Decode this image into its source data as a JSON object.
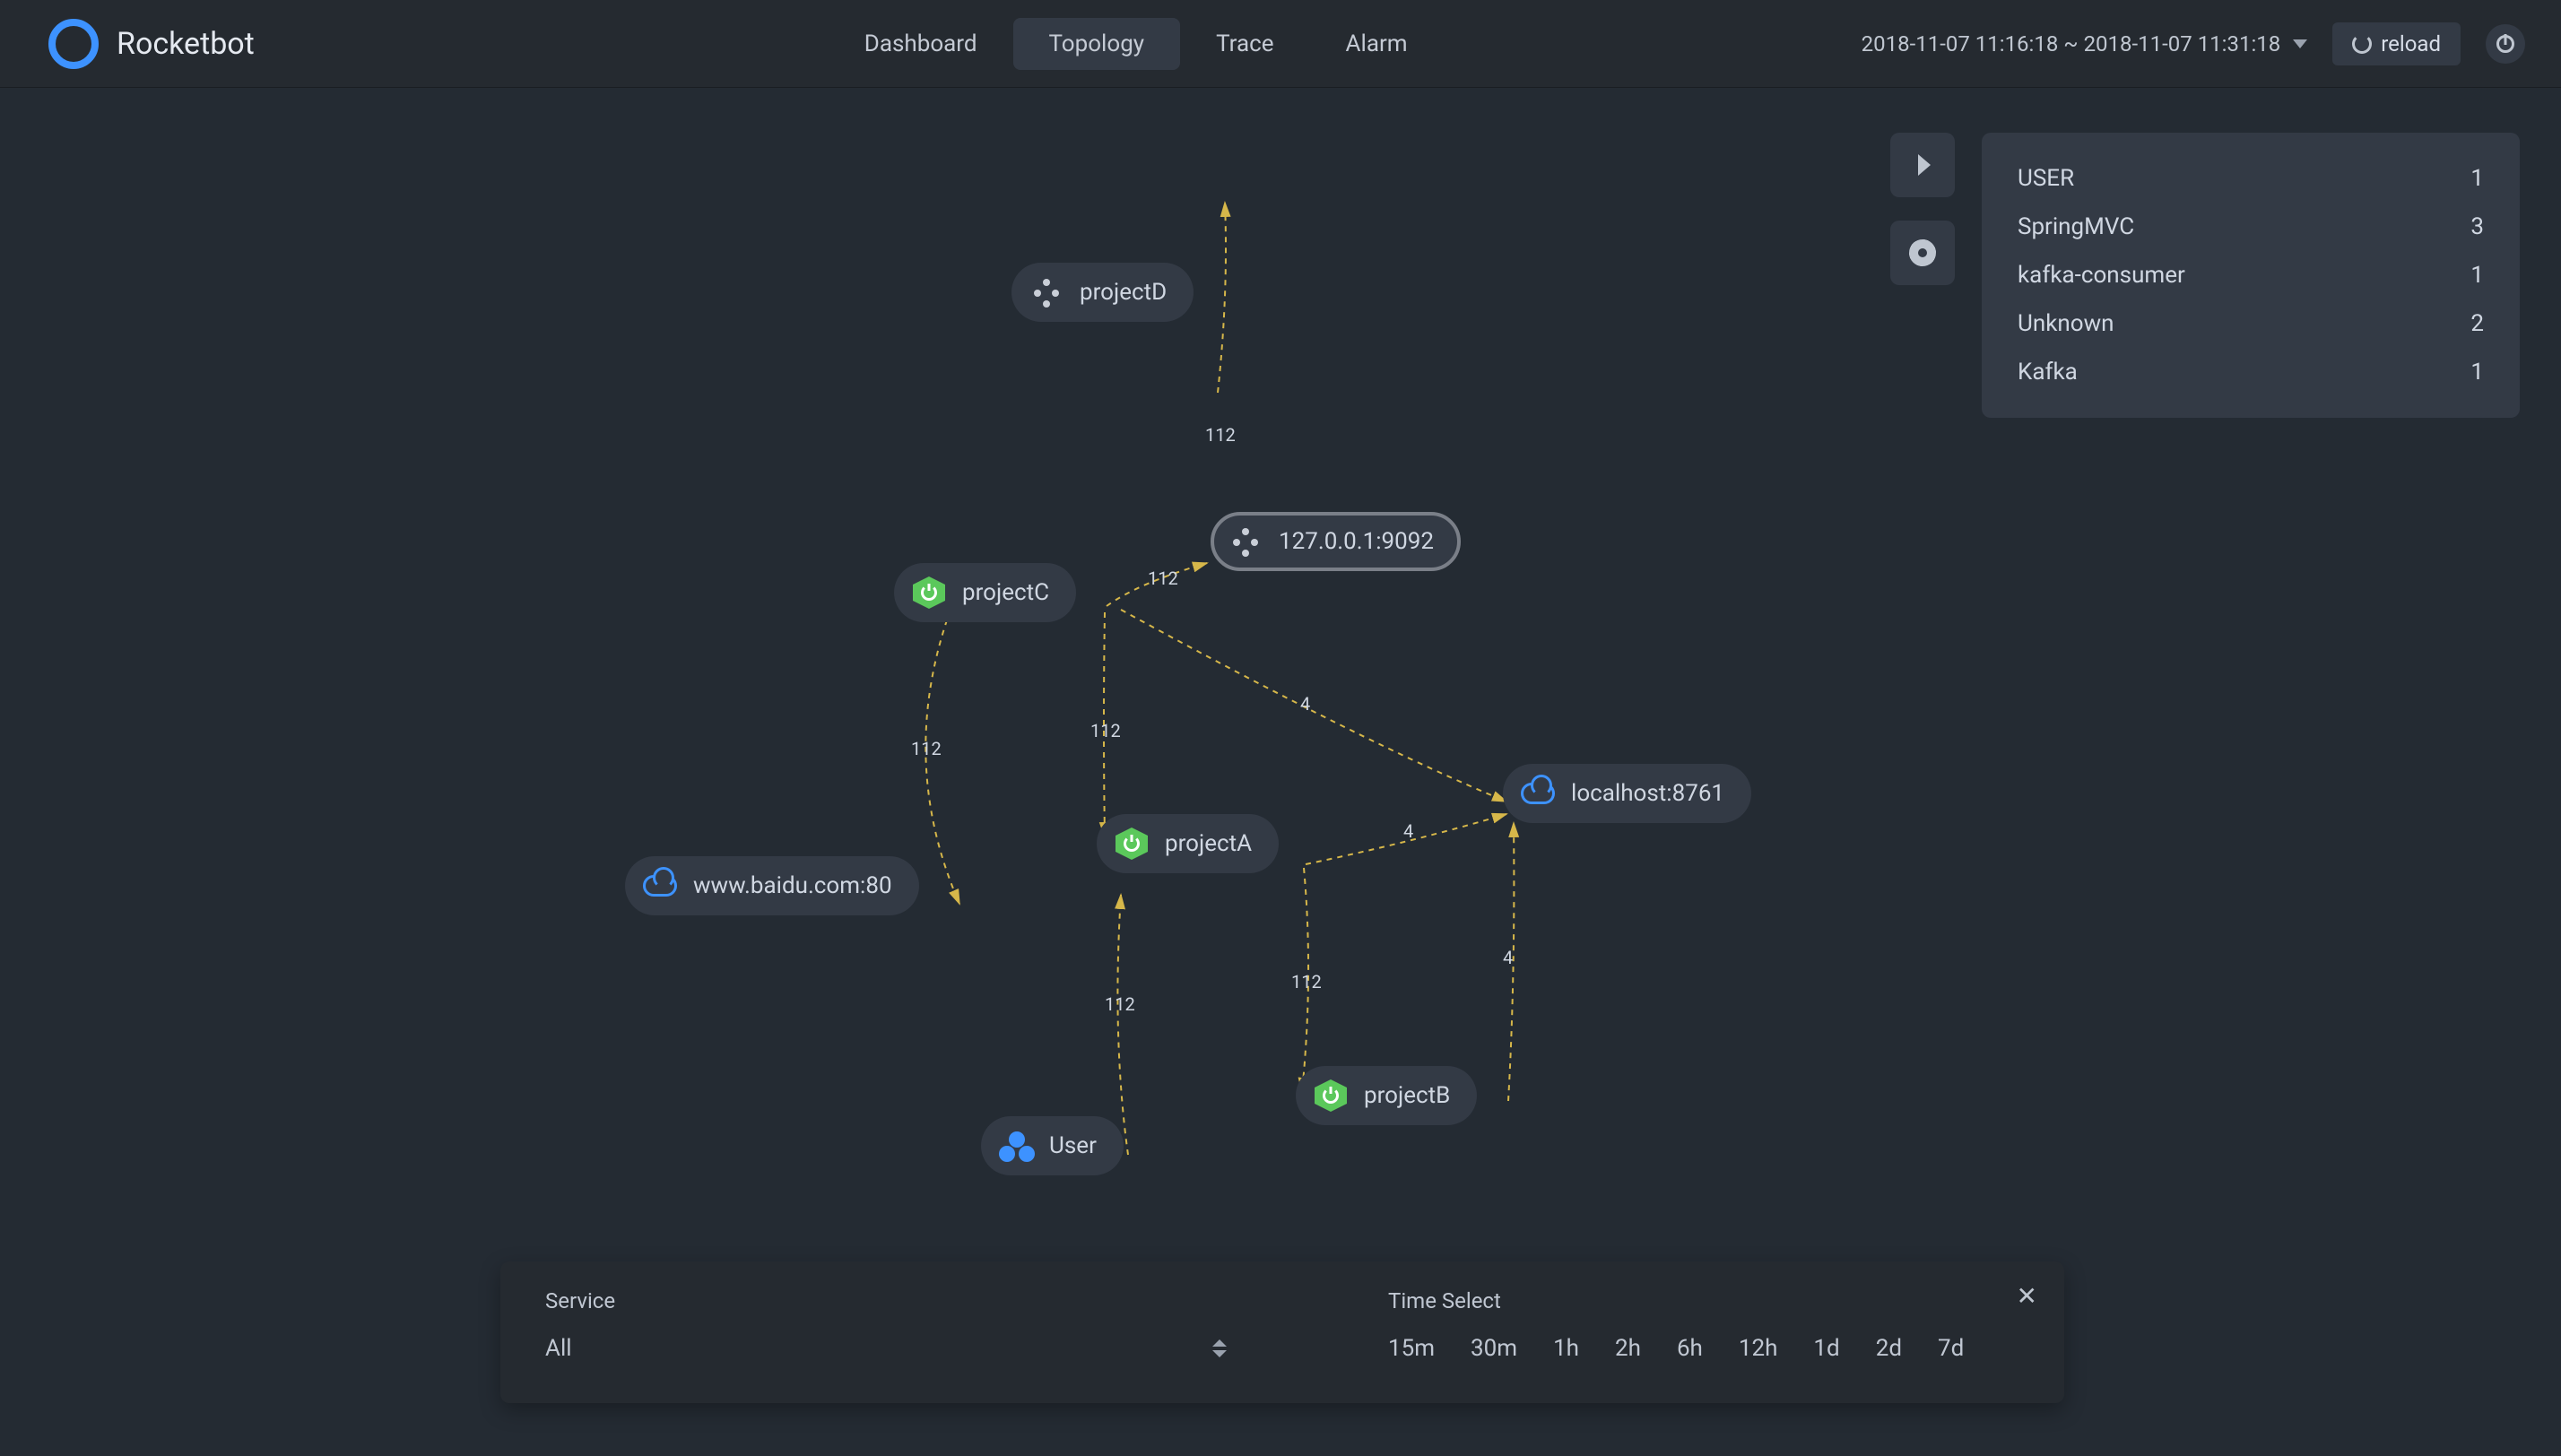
{
  "header": {
    "app_name": "Rocketbot",
    "nav": {
      "dashboard": "Dashboard",
      "topology": "Topology",
      "trace": "Trace",
      "alarm": "Alarm"
    },
    "timerange": "2018-11-07 11:16:18 ~ 2018-11-07 11:31:18",
    "reload_label": "reload"
  },
  "legend": [
    {
      "name": "USER",
      "count": "1"
    },
    {
      "name": "SpringMVC",
      "count": "3"
    },
    {
      "name": "kafka-consumer",
      "count": "1"
    },
    {
      "name": "Unknown",
      "count": "2"
    },
    {
      "name": "Kafka",
      "count": "1"
    }
  ],
  "nodes": {
    "projectD": "projectD",
    "kafka": "127.0.0.1:9092",
    "projectC": "projectC",
    "projectA": "projectA",
    "projectB": "projectB",
    "user": "User",
    "baidu": "www.baidu.com:80",
    "localhost": "localhost:8761"
  },
  "edge_labels": {
    "d": "112",
    "c_kafka": "112",
    "c_a": "112",
    "c_baidu": "112",
    "a_user": "112",
    "a_b": "112",
    "a_localhost": "4",
    "b_localhost": "4",
    "kafka_localhost": "4"
  },
  "bottom": {
    "service_label": "Service",
    "service_value": "All",
    "time_select_label": "Time Select",
    "time_options": [
      "15m",
      "30m",
      "1h",
      "2h",
      "6h",
      "12h",
      "1d",
      "2d",
      "7d"
    ]
  }
}
